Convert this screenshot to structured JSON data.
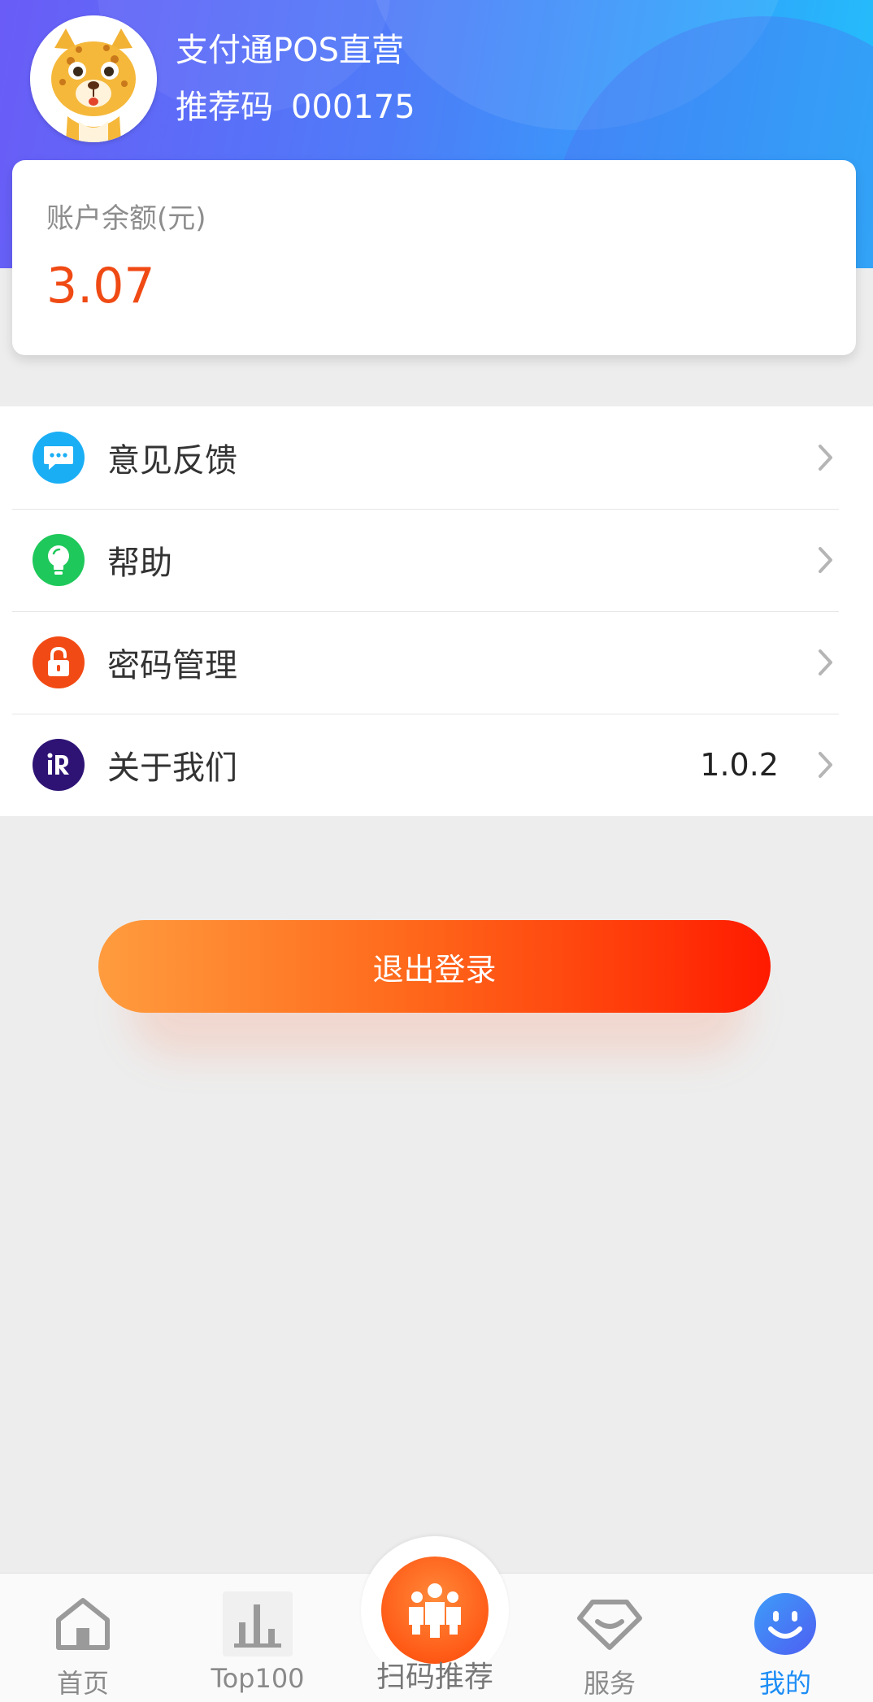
{
  "header": {
    "store_name": "支付通POS直营",
    "referral_label": "推荐码",
    "referral_code": "000175"
  },
  "balance": {
    "label": "账户余额(元)",
    "value": "3.07"
  },
  "menu": {
    "items": [
      {
        "label": "意见反馈",
        "icon": "chat-bubble-icon",
        "color": "#1aaef5",
        "value": ""
      },
      {
        "label": "帮助",
        "icon": "lightbulb-icon",
        "color": "#1ec85a",
        "value": ""
      },
      {
        "label": "密码管理",
        "icon": "lock-icon",
        "color": "#f24a14",
        "value": ""
      },
      {
        "label": "关于我们",
        "icon": "ir-logo-icon",
        "color": "#2e1375",
        "value": "1.0.2"
      }
    ]
  },
  "logout": {
    "label": "退出登录"
  },
  "tabbar": {
    "items": [
      {
        "label": "首页",
        "icon": "home-icon"
      },
      {
        "label": "Top100",
        "icon": "bar-chart-icon"
      },
      {
        "label": "扫码推荐",
        "icon": "people-icon"
      },
      {
        "label": "服务",
        "icon": "diamond-icon"
      },
      {
        "label": "我的",
        "icon": "smiley-icon",
        "active": true
      }
    ]
  },
  "colors": {
    "accent": "#1d8df5",
    "balance": "#f04a14",
    "logout_start": "#ff9c3e",
    "logout_end": "#ff1a00"
  }
}
